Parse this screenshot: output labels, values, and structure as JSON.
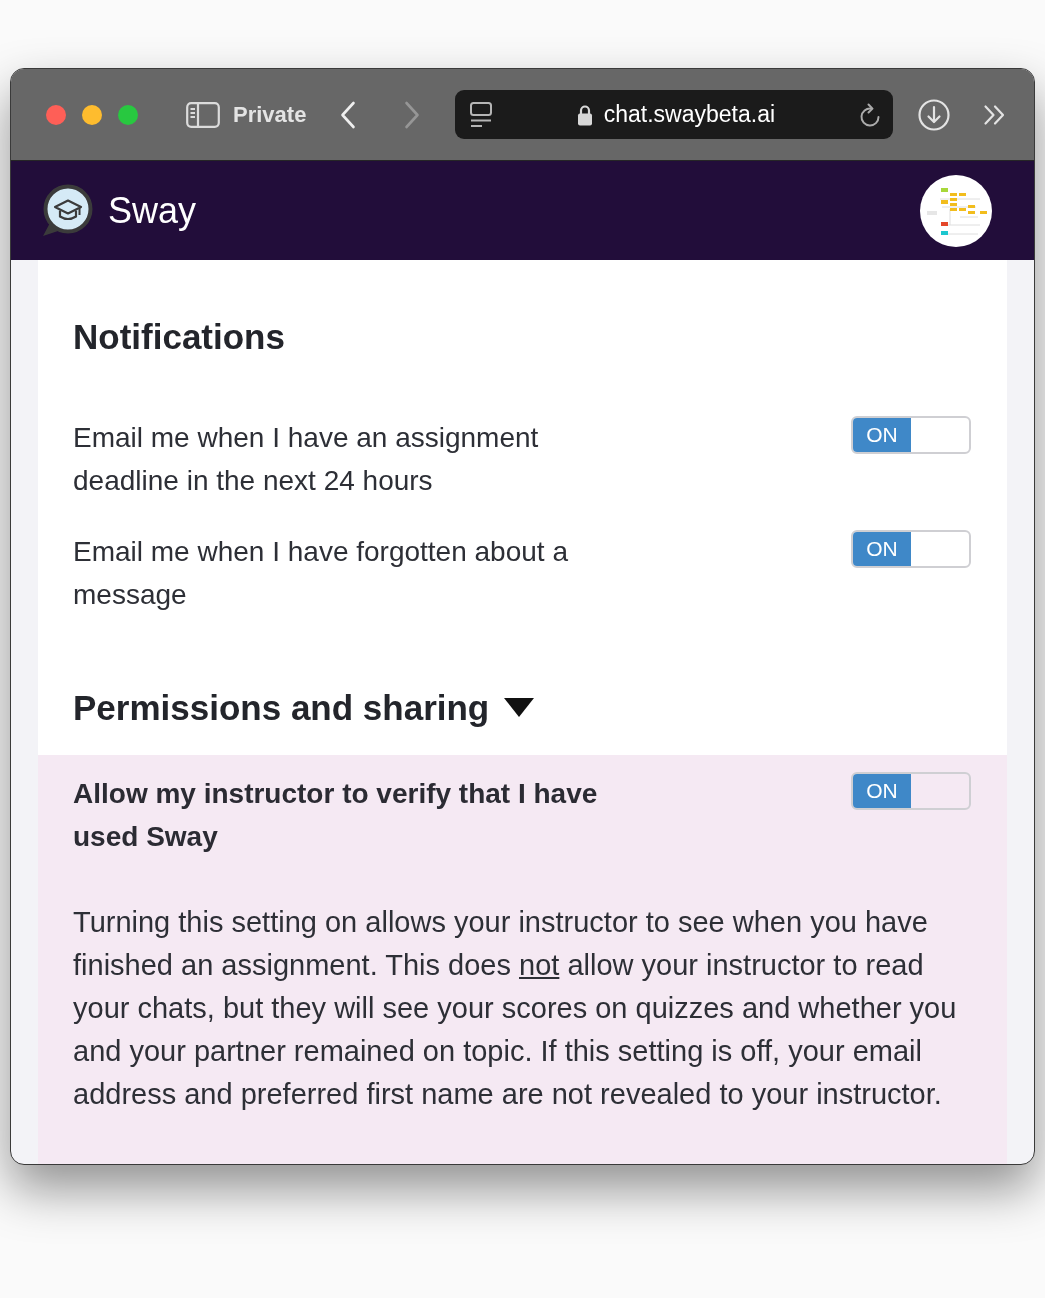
{
  "browser": {
    "profile_label": "Private",
    "url": "chat.swaybeta.ai"
  },
  "header": {
    "app_name": "Sway"
  },
  "notifications": {
    "title": "Notifications",
    "settings": [
      {
        "label": "Email me when I have an assignment deadline in the next 24 hours",
        "on": true,
        "toggle_text": "ON"
      },
      {
        "label": "Email me when I have forgotten about a message",
        "on": true,
        "toggle_text": "ON"
      }
    ]
  },
  "permissions": {
    "title": "Permissions and sharing",
    "expanded": true,
    "settings": [
      {
        "label": "Allow my instructor to verify that I have used Sway",
        "on": true,
        "toggle_text": "ON"
      }
    ],
    "description": [
      {
        "text": "Turning this setting on allows your instructor to see when you have finished an assignment. This does ",
        "underlined": false
      },
      {
        "text": "not",
        "underlined": true
      },
      {
        "text": " allow your instructor to read your chats, but they will see your scores on quizzes and whether you and your partner remained on topic. If this setting is off, your email address and preferred first name are not revealed to your instructor.",
        "underlined": false
      }
    ]
  }
}
